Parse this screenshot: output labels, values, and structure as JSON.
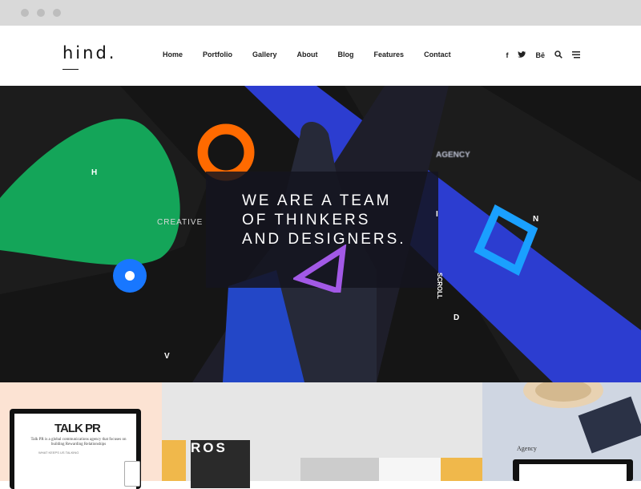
{
  "brand": {
    "logo": "hind."
  },
  "nav": {
    "items": [
      "Home",
      "Portfolio",
      "Gallery",
      "About",
      "Blog",
      "Features",
      "Contact"
    ]
  },
  "social": {
    "facebook": "f",
    "twitter": "🐦",
    "behance": "Bē",
    "search": "⌕",
    "menu": "≡"
  },
  "hero": {
    "tagline_lines": [
      "WE ARE A TEAM",
      "OF THINKERS",
      "AND DESIGNERS."
    ],
    "letters": {
      "h": "H",
      "i": "I",
      "n": "N",
      "d": "D",
      "v": "V"
    },
    "agency": "AGENCY",
    "creative": "CREATIVE",
    "scroll": "SCROLL"
  },
  "gallery": {
    "talkpr_title": "TALK PR",
    "talkpr_desc": "Talk PR is a global communications agency that focuses on building Rewarding Relationships",
    "talkpr_sub": "WHAT KEEPS US TALKING",
    "stamp_letters": "ROS",
    "agency_caption": "Agency"
  },
  "colors": {
    "green": "#14a559",
    "orange": "#ff6a00",
    "blue": "#1877ff",
    "royal": "#2c3dd0",
    "purple": "#a259e6",
    "cyan": "#1aa0ff"
  }
}
